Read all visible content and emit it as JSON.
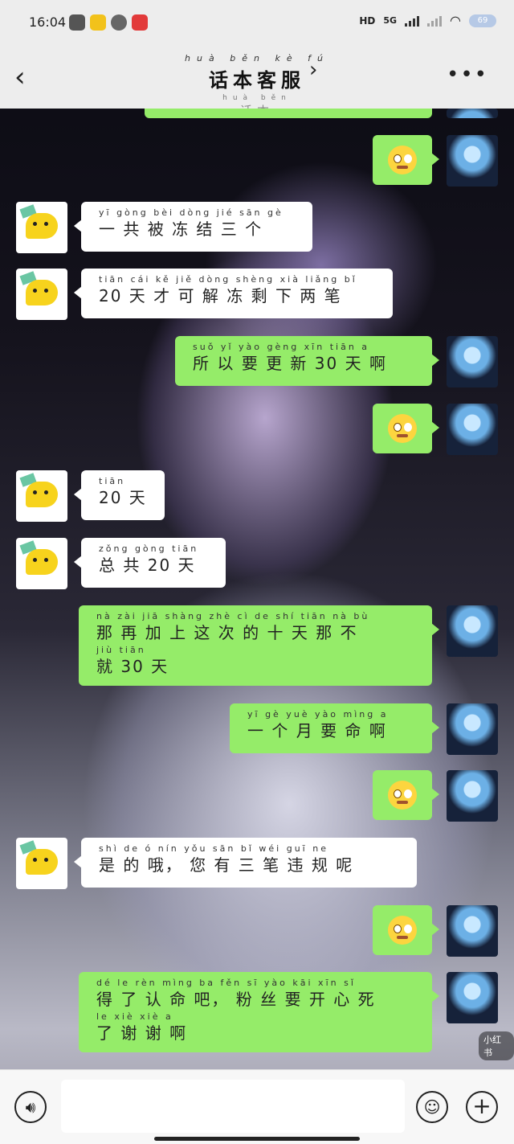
{
  "status_bar": {
    "time": "16:04",
    "hd": "HD",
    "network": "5G",
    "battery": "69",
    "app_icons": [
      "android-robot-icon",
      "notification-app-icon",
      "browser-icon",
      "netease-music-icon"
    ]
  },
  "header": {
    "title": "话本客服",
    "title_pinyin": "huà běn kè fú",
    "subtitle": "话本",
    "subtitle_pinyin": "huà běn"
  },
  "messages": [
    {
      "side": "out",
      "type": "sticker",
      "sticker": "nervous-face-emoji"
    },
    {
      "side": "in",
      "type": "text",
      "lines": [
        {
          "py": "yī gòng bèi dòng jié sān gè",
          "hz": "一 共 被 冻 结 三 个"
        }
      ]
    },
    {
      "side": "in",
      "type": "text",
      "lines": [
        {
          "py": "tiān cái kě jiě dòng shèng xià liǎng bǐ",
          "hz": "20 天 才 可 解 冻 剩 下 两 笔"
        }
      ]
    },
    {
      "side": "out",
      "type": "text",
      "lines": [
        {
          "py": "suǒ yǐ yào gèng xīn tiān a",
          "hz": "所 以 要 更 新 30 天 啊"
        }
      ]
    },
    {
      "side": "out",
      "type": "sticker",
      "sticker": "nervous-face-emoji"
    },
    {
      "side": "in",
      "type": "text",
      "lines": [
        {
          "py": "tiān",
          "hz": "20 天"
        }
      ]
    },
    {
      "side": "in",
      "type": "text",
      "lines": [
        {
          "py": "zǒng gòng tiān",
          "hz": "总 共 20 天"
        }
      ]
    },
    {
      "side": "out",
      "type": "text",
      "lines": [
        {
          "py": "nà zài jiā shàng zhè cì de shí tiān nà bù",
          "hz": "那 再 加 上 这 次 的 十 天 那 不"
        },
        {
          "py": "jiù tiān",
          "hz": "就 30 天"
        }
      ]
    },
    {
      "side": "out",
      "type": "text",
      "lines": [
        {
          "py": "yī gè yuè yào mìng a",
          "hz": "一 个 月 要 命 啊"
        }
      ]
    },
    {
      "side": "out",
      "type": "sticker",
      "sticker": "nervous-face-emoji"
    },
    {
      "side": "in",
      "type": "text",
      "lines": [
        {
          "py": "shì de ó nín yǒu sān bǐ wéi guī ne",
          "hz": "是 的 哦， 您 有 三 笔 违 规 呢"
        }
      ]
    },
    {
      "side": "out",
      "type": "sticker",
      "sticker": "nervous-face-emoji"
    },
    {
      "side": "out",
      "type": "text",
      "lines": [
        {
          "py": "dé le rèn mìng ba fěn sī yào kāi xīn sǐ",
          "hz": "得 了 认 命 吧， 粉 丝 要 开 心 死"
        },
        {
          "py": "le xiè xiè a",
          "hz": "了 谢 谢 啊"
        }
      ]
    }
  ],
  "watermark": "小红书",
  "colors": {
    "outgoing_bubble": "#95ec69",
    "incoming_bubble": "#ffffff",
    "bar_bg": "#ededed"
  },
  "bottom_bar": {
    "voice_icon": "voice-icon",
    "emoji_icon": "emoji-icon",
    "plus_icon": "plus-icon"
  }
}
